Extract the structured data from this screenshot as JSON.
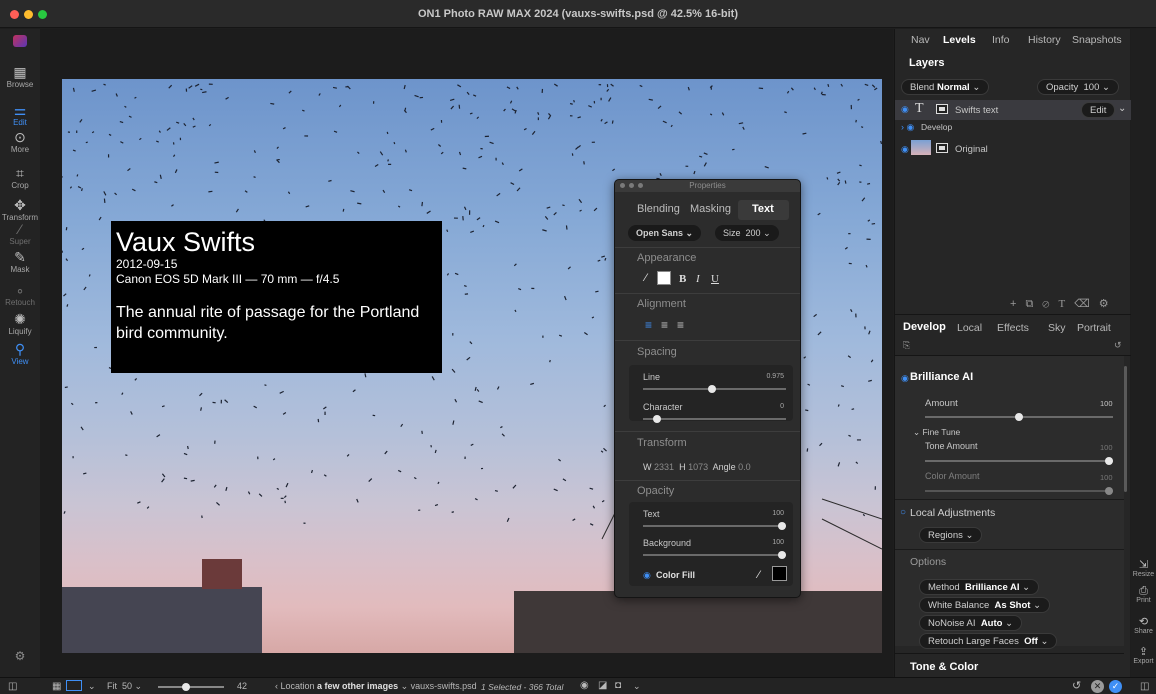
{
  "window": {
    "title": "ON1 Photo RAW MAX 2024 (vauxs-swifts.psd @ 42.5% 16-bit)",
    "dot_colors": [
      "#ff5f57",
      "#febc2e",
      "#28c840"
    ]
  },
  "toolbar": {
    "items": [
      {
        "label": "Browse",
        "icon": "grid-icon",
        "glyph": "▦",
        "state": "normal"
      },
      {
        "label": "Edit",
        "icon": "sliders-icon",
        "glyph": "⚌",
        "state": "active"
      },
      {
        "label": "More",
        "icon": "more-icon",
        "glyph": "⊙",
        "state": "normal"
      },
      {
        "label": "Crop",
        "icon": "crop-icon",
        "glyph": "⌗",
        "state": "normal"
      },
      {
        "label": "Transform",
        "icon": "transform-icon",
        "glyph": "✥",
        "state": "normal"
      },
      {
        "label": "Super",
        "icon": "wand-icon",
        "glyph": "⁄",
        "state": "dim"
      },
      {
        "label": "Mask",
        "icon": "mask-brush-icon",
        "glyph": "✎",
        "state": "normal"
      },
      {
        "label": "Retouch",
        "icon": "retouch-icon",
        "glyph": "∘",
        "state": "dim"
      },
      {
        "label": "Liquify",
        "icon": "liquify-icon",
        "glyph": "✺",
        "state": "normal"
      },
      {
        "label": "View",
        "icon": "view-zoom-icon",
        "glyph": "⚲",
        "state": "active"
      }
    ]
  },
  "overlay": {
    "title": "Vaux Swifts",
    "date": "2012-09-15",
    "camera": "Canon EOS 5D Mark III — 70 mm — f/4.5",
    "description": "The annual rite of passage for the Portland bird community."
  },
  "sign_text": "…",
  "properties": {
    "title": "Properties",
    "tabs": [
      "Blending",
      "Masking",
      "Text"
    ],
    "active_tab": "Text",
    "font": "Open Sans",
    "size_label": "Size",
    "size_value": "200",
    "appearance_label": "Appearance",
    "bold": "B",
    "italic": "I",
    "underline": "U",
    "alignment_label": "Alignment",
    "spacing_label": "Spacing",
    "line_label": "Line",
    "line_value": "0.975",
    "line_fraction": 0.48,
    "character_label": "Character",
    "character_value": "0",
    "character_fraction": 0.1,
    "transform_label": "Transform",
    "w_label": "W",
    "w_value": "2331",
    "h_label": "H",
    "h_value": "1073",
    "angle_label": "Angle",
    "angle_value": "0.0",
    "opacity_label": "Opacity",
    "text_op_label": "Text",
    "text_op_value": "100",
    "bg_op_label": "Background",
    "bg_op_value": "100",
    "color_fill_label": "Color Fill"
  },
  "right_panel": {
    "top_tabs": [
      "Nav",
      "Levels",
      "Info",
      "History",
      "Snapshots"
    ],
    "active_top_tab": "Levels",
    "layers_title": "Layers",
    "blend_label": "Blend",
    "blend_value": "Normal",
    "opacity_label": "Opacity",
    "opacity_value": "100",
    "layers": [
      {
        "name": "Swifts text",
        "action": "Edit"
      },
      {
        "name": "Develop"
      },
      {
        "name": "Original"
      }
    ],
    "module_tabs": [
      "Develop",
      "Local",
      "Effects",
      "Sky",
      "Portrait"
    ],
    "active_module_tab": "Develop",
    "brilliance_title": "Brilliance AI",
    "amount_label": "Amount",
    "amount_value": "100",
    "amount_fraction": 0.5,
    "fine_tune_label": "Fine Tune",
    "tone_amount_label": "Tone Amount",
    "tone_amount_value": "100",
    "tone_amount_fraction": 1.0,
    "color_amount_label": "Color Amount",
    "color_amount_value": "100",
    "color_amount_fraction": 1.0,
    "local_adjustments_label": "Local Adjustments",
    "regions_label": "Regions",
    "options_label": "Options",
    "method_label": "Method",
    "method_value": "Brilliance AI",
    "wb_label": "White Balance",
    "wb_value": "As Shot",
    "noise_label": "NoNoise AI",
    "noise_value": "Auto",
    "retouch_label": "Retouch Large Faces",
    "retouch_value": "Off",
    "tone_color_label": "Tone & Color"
  },
  "far_right": {
    "items": [
      {
        "label": "Resize",
        "icon": "resize-icon",
        "glyph": "⇲"
      },
      {
        "label": "Print",
        "icon": "print-icon",
        "glyph": "⎙"
      },
      {
        "label": "Share",
        "icon": "share-icon",
        "glyph": "⟲"
      },
      {
        "label": "Export",
        "icon": "export-icon",
        "glyph": "⇪"
      }
    ]
  },
  "bottom_bar": {
    "fit_label": "Fit",
    "fit_value": "50",
    "zoom_value": "42",
    "location_prefix": "‹ Location",
    "location_value": "a few other images",
    "file_name": "vauxs-swifts.psd",
    "selection_status": "1 Selected - 366 Total",
    "thumb_size_fraction": 0.42
  },
  "colors": {
    "accent": "#3f8ff5",
    "panel": "#262626"
  }
}
